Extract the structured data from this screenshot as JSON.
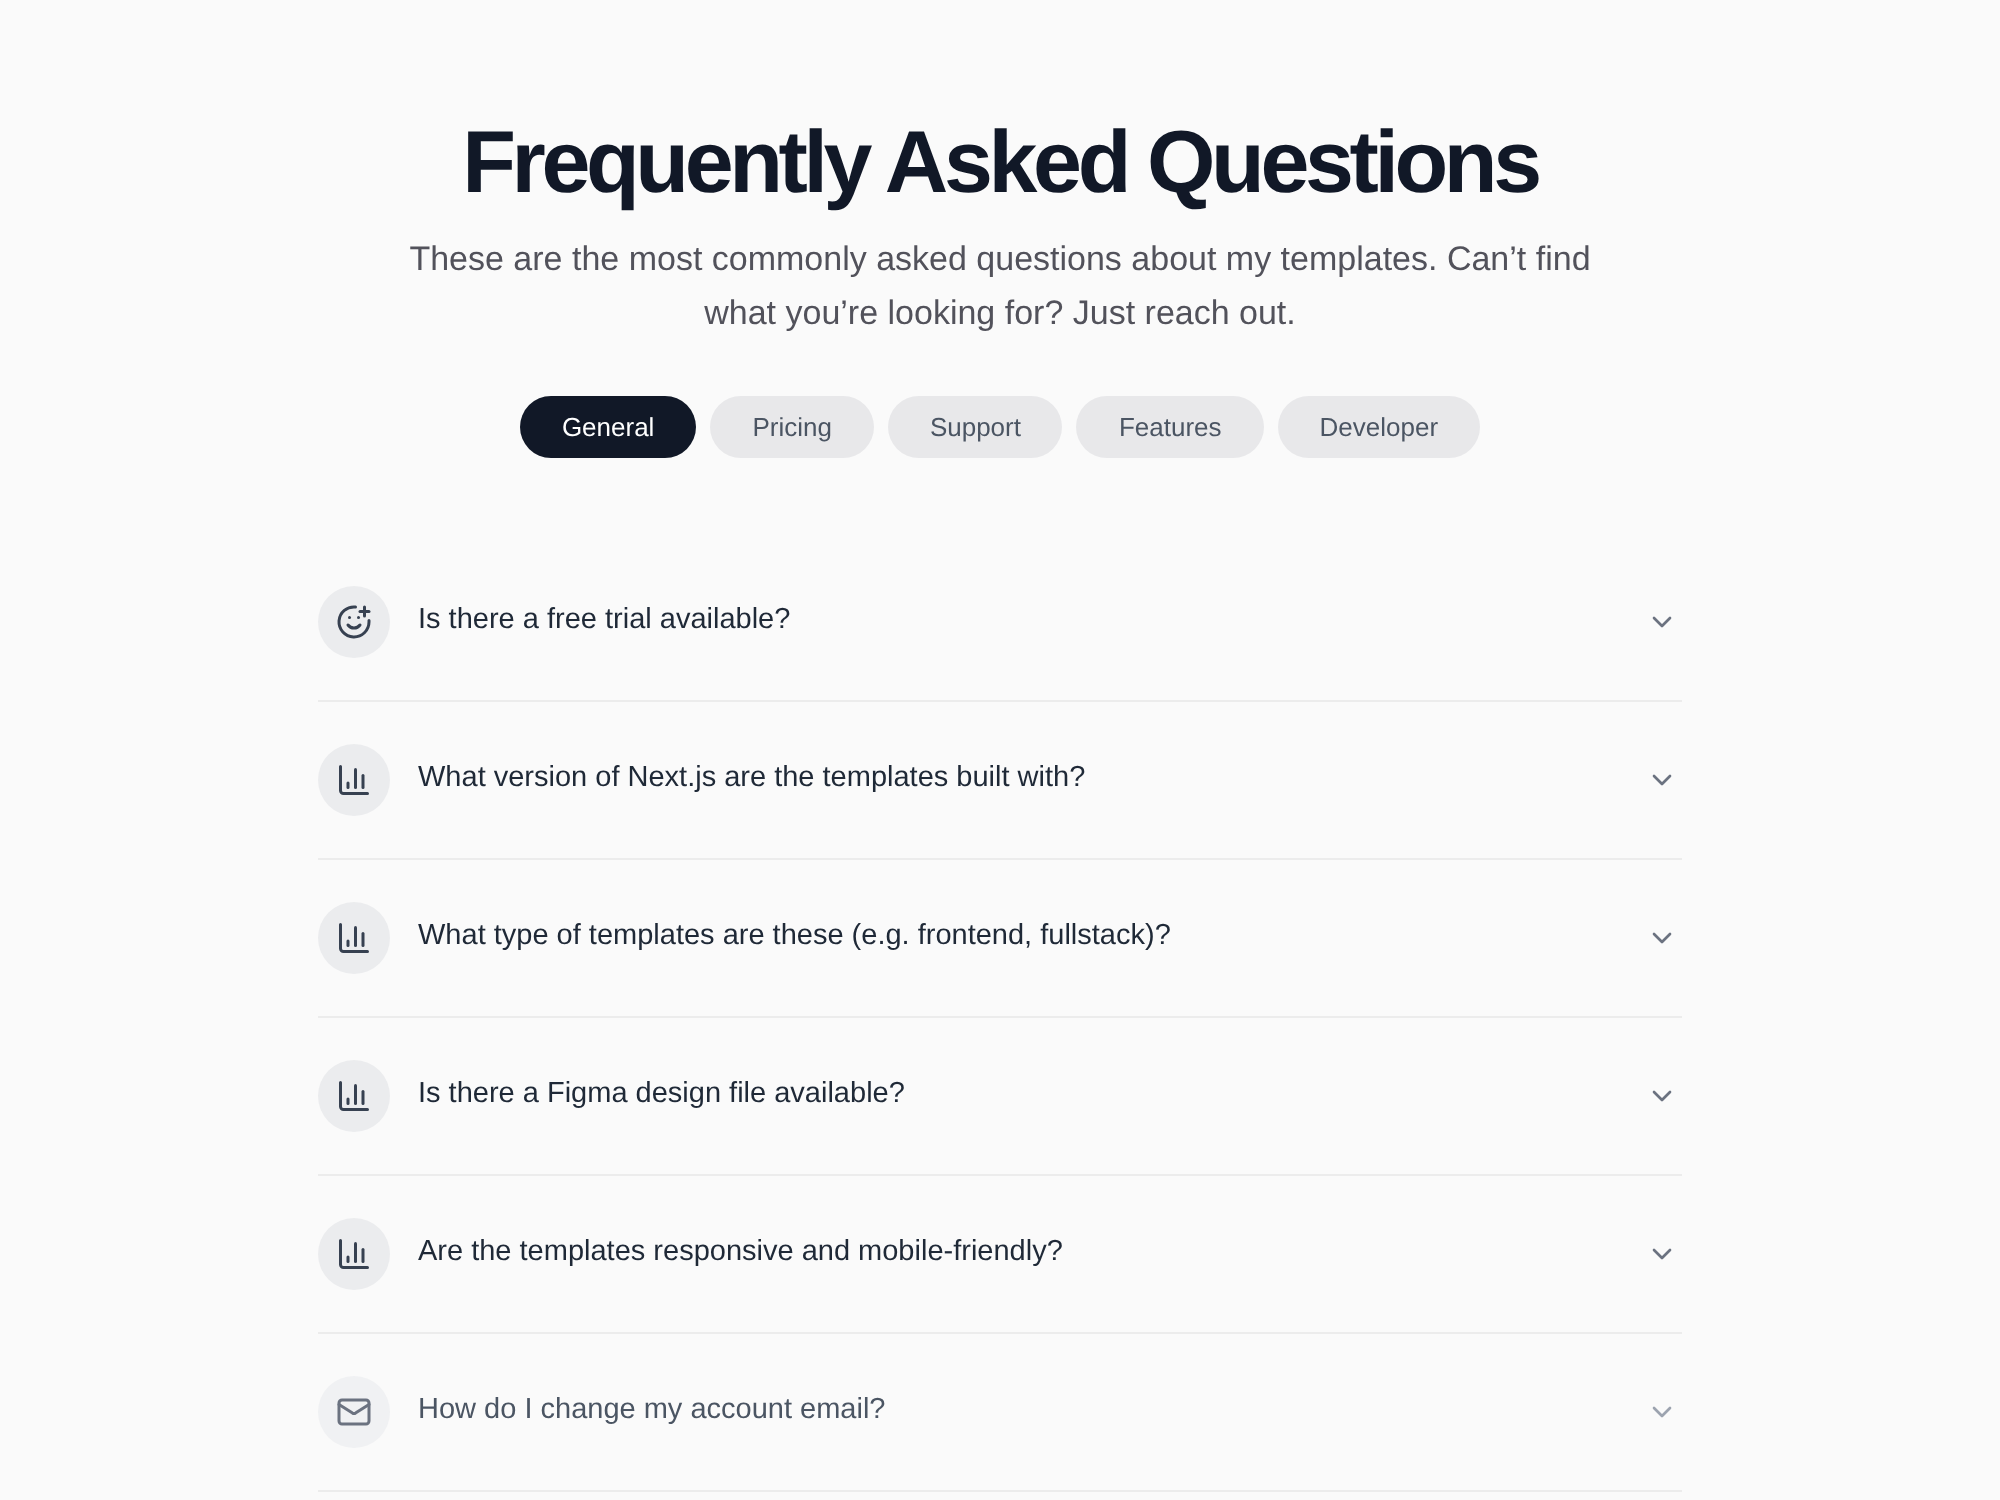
{
  "header": {
    "title": "Frequently Asked Questions",
    "subtitle": "These are the most commonly asked questions about my templates. Can’t find what you’re looking for? Just reach out."
  },
  "tabs": [
    {
      "label": "General",
      "selected": true
    },
    {
      "label": "Pricing",
      "selected": false
    },
    {
      "label": "Support",
      "selected": false
    },
    {
      "label": "Features",
      "selected": false
    },
    {
      "label": "Developer",
      "selected": false
    }
  ],
  "faq": [
    {
      "kind": "smile",
      "question": "Is there a free trial available?",
      "expanded": false,
      "muted": false
    },
    {
      "kind": "chart",
      "question": "What version of Next.js are the templates built with?",
      "expanded": false,
      "muted": false
    },
    {
      "kind": "chart",
      "question": "What type of templates are these (e.g. frontend, fullstack)?",
      "expanded": false,
      "muted": false
    },
    {
      "kind": "chart",
      "question": "Is there a Figma design file available?",
      "expanded": false,
      "muted": false
    },
    {
      "kind": "chart",
      "question": "Are the templates responsive and mobile-friendly?",
      "expanded": false,
      "muted": false
    },
    {
      "kind": "mail",
      "question": "How do I change my account email?",
      "expanded": false,
      "muted": true
    }
  ]
}
